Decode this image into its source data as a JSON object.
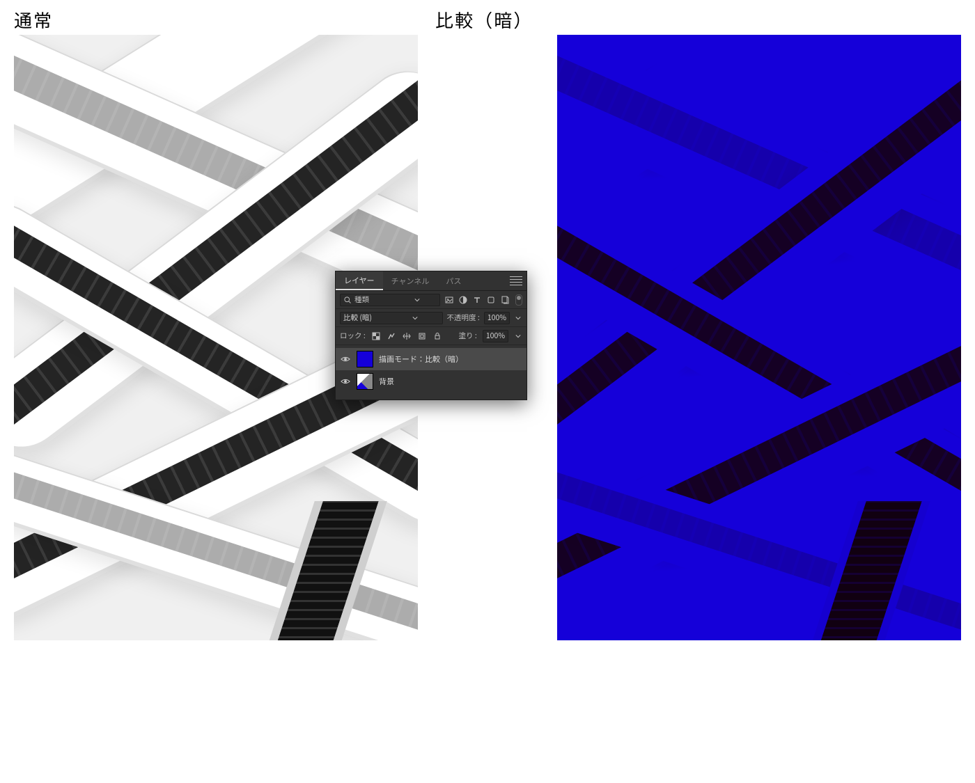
{
  "captions": {
    "left": "通常",
    "right": "比較（暗）"
  },
  "panel": {
    "tabs": {
      "layers": "レイヤー",
      "channels": "チャンネル",
      "paths": "パス"
    },
    "search_label": "種類",
    "blend_mode_value": "比較 (暗)",
    "opacity_label": "不透明度 :",
    "opacity_value": "100%",
    "lock_label": "ロック :",
    "fill_label": "塗り :",
    "fill_value": "100%",
    "layers": [
      {
        "name": "描画モード：比較（暗）",
        "selected": true,
        "thumb": "blue"
      },
      {
        "name": "背景",
        "selected": false,
        "thumb": "bg"
      }
    ]
  },
  "colors": {
    "overlay_blue": "#1500d9"
  }
}
